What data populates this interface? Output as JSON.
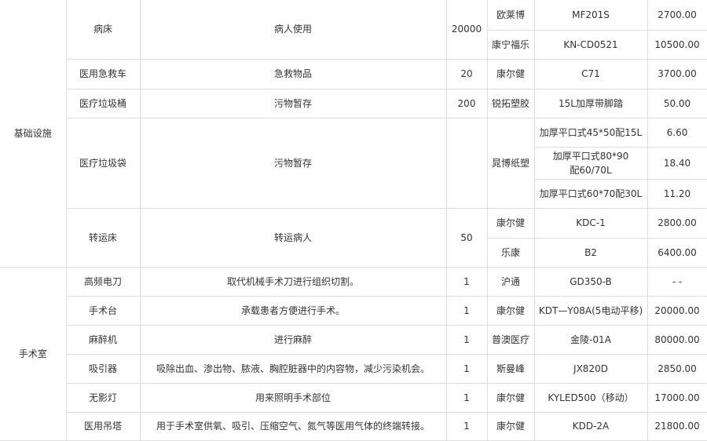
{
  "table": {
    "groups": [
      {
        "category": "基础设施",
        "items": [
          {
            "name": "病床",
            "usage": "病人使用",
            "quantity": "20000",
            "suppliers": [
              {
                "brand": "欧莱博",
                "models": [
                  {
                    "model": "MF201S",
                    "price": "2700.00"
                  }
                ]
              },
              {
                "brand": "康宁福乐",
                "models": [
                  {
                    "model": "KN-CD0521",
                    "price": "10500.00"
                  }
                ]
              }
            ]
          },
          {
            "name": "医用急救车",
            "usage": "急救物品",
            "quantity": "20",
            "suppliers": [
              {
                "brand": "康尔健",
                "models": [
                  {
                    "model": "C71",
                    "price": "3700.00"
                  }
                ]
              }
            ]
          },
          {
            "name": "医疗垃圾桶",
            "usage": "污物暂存",
            "quantity": "200",
            "suppliers": [
              {
                "brand": "锐拓塑胶",
                "models": [
                  {
                    "model": "15L加厚带脚踏",
                    "price": "50.00"
                  }
                ]
              }
            ]
          },
          {
            "name": "医疗垃圾袋",
            "usage": "污物暂存",
            "quantity": "",
            "suppliers": [
              {
                "brand": "晁博纸塑",
                "models": [
                  {
                    "model": "加厚平口式45*50配15L",
                    "price": "6.60"
                  },
                  {
                    "model": "加厚平口式80*90配60/70L",
                    "price": "18.40"
                  },
                  {
                    "model": "加厚平口式60*70配30L",
                    "price": "11.20"
                  }
                ]
              }
            ]
          },
          {
            "name": "转运床",
            "usage": "转运病人",
            "quantity": "50",
            "suppliers": [
              {
                "brand": "康尔健",
                "models": [
                  {
                    "model": "KDC-1",
                    "price": "2800.00"
                  }
                ]
              },
              {
                "brand": "乐康",
                "models": [
                  {
                    "model": "B2",
                    "price": "6400.00"
                  }
                ]
              }
            ]
          }
        ]
      },
      {
        "category": "手术室",
        "items": [
          {
            "name": "高频电刀",
            "usage": "取代机械手术刀进行组织切割。",
            "quantity": "1",
            "suppliers": [
              {
                "brand": "沪通",
                "models": [
                  {
                    "model": "GD350-B",
                    "price": "- -"
                  }
                ]
              }
            ]
          },
          {
            "name": "手术台",
            "usage": "承载患者方便进行手术。",
            "quantity": "1",
            "suppliers": [
              {
                "brand": "康尔健",
                "models": [
                  {
                    "model": "KDT—Y08A(5电动平移)",
                    "price": "20000.00"
                  }
                ]
              }
            ]
          },
          {
            "name": "麻醉机",
            "usage": "进行麻醉",
            "quantity": "1",
            "suppliers": [
              {
                "brand": "普澳医疗",
                "models": [
                  {
                    "model": "金陵-01A",
                    "price": "80000.00"
                  }
                ]
              }
            ]
          },
          {
            "name": "吸引器",
            "usage": "吸除出血、渗出物、脓液、胸腔脏器中的内容物，减少污染机会。",
            "quantity": "1",
            "suppliers": [
              {
                "brand": "斯曼峰",
                "models": [
                  {
                    "model": "JX820D",
                    "price": "2850.00"
                  }
                ]
              }
            ]
          },
          {
            "name": "无影灯",
            "usage": "用来照明手术部位",
            "quantity": "1",
            "suppliers": [
              {
                "brand": "康尔健",
                "models": [
                  {
                    "model": "KYLED500（移动）",
                    "price": "17000.00"
                  }
                ]
              }
            ]
          },
          {
            "name": "医用吊塔",
            "usage": "用于手术室供氧、吸引、压缩空气、氮气等医用气体的终端转接。",
            "quantity": "1",
            "suppliers": [
              {
                "brand": "康尔健",
                "models": [
                  {
                    "model": "KDD-2A",
                    "price": "21800.00"
                  }
                ]
              }
            ]
          }
        ]
      }
    ]
  }
}
